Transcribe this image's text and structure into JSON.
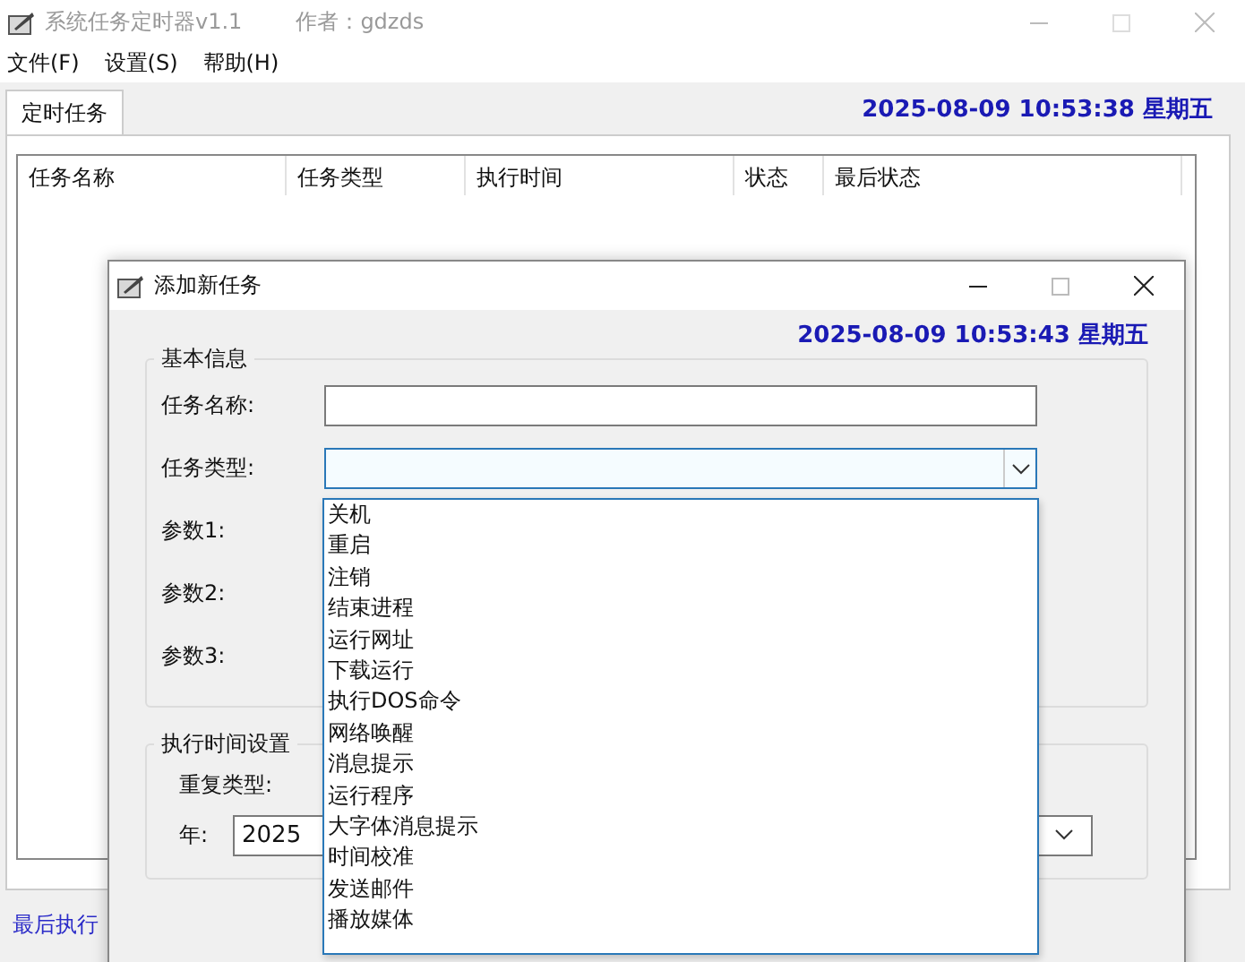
{
  "main_window": {
    "title": "系统任务定时器v1.1",
    "author": "作者：gdzds",
    "menu": [
      "文件(F)",
      "设置(S)",
      "帮助(H)"
    ],
    "tabs": [
      {
        "label": "定时任务",
        "selected": true
      }
    ],
    "clock": "2025-08-09 10:53:38 星期五",
    "table": {
      "columns": [
        "任务名称",
        "任务类型",
        "执行时间",
        "状态",
        "最后状态"
      ]
    },
    "status_link": "最后执行"
  },
  "dialog": {
    "title": "添加新任务",
    "clock": "2025-08-09 10:53:43 星期五",
    "groups": [
      {
        "title": "基本信息",
        "fields": [
          {
            "label": "任务名称:",
            "kind": "text",
            "focused": false
          },
          {
            "label": "任务类型:",
            "kind": "combo",
            "focused": true
          },
          {
            "label": "参数1:",
            "kind": "label"
          },
          {
            "label": "参数2:",
            "kind": "label"
          },
          {
            "label": "参数3:",
            "kind": "label"
          }
        ]
      },
      {
        "title": "执行时间设置",
        "fields": [
          {
            "label": "重复类型:",
            "kind": "label"
          },
          {
            "label": "年:",
            "kind": "combo",
            "focused": false,
            "value": "2025"
          }
        ]
      }
    ],
    "dropdown": [
      "关机",
      "重启",
      "注销",
      "结束进程",
      "运行网址",
      "下载运行",
      "执行DOS命令",
      "网络唤醒",
      "消息提示",
      "运行程序",
      "大字体消息提示",
      "时间校准",
      "发送邮件",
      "播放媒体"
    ]
  }
}
